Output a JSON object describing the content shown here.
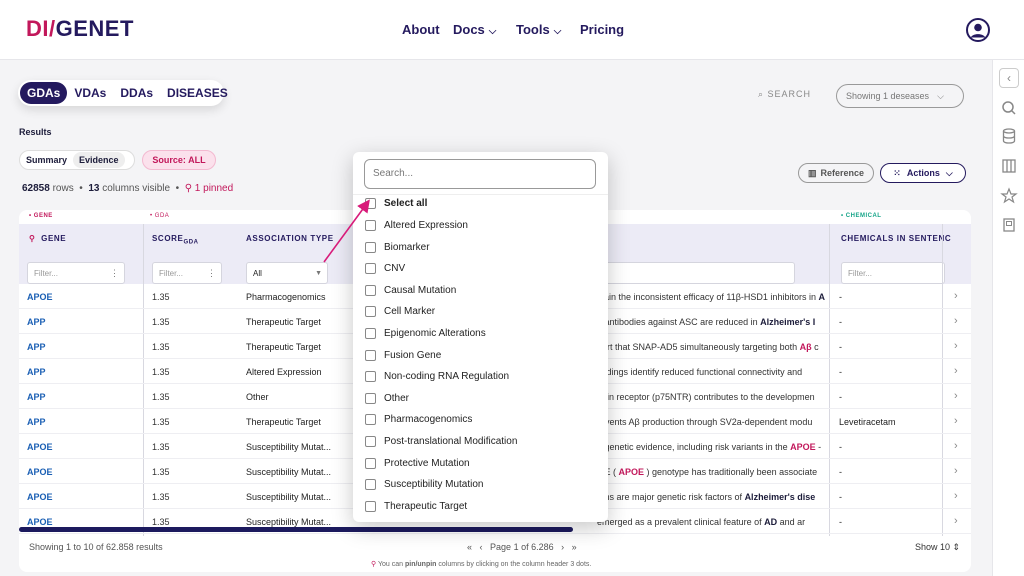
{
  "header": {
    "logo_part1": "DI",
    "logo_part2": "GENET",
    "nav": [
      {
        "label": "About",
        "has_menu": false
      },
      {
        "label": "Docs",
        "has_menu": true
      },
      {
        "label": "Tools",
        "has_menu": true
      },
      {
        "label": "Pricing",
        "has_menu": false
      }
    ]
  },
  "tabs": [
    "GDAs",
    "VDAs",
    "DDAs",
    "DISEASES"
  ],
  "active_tab": "GDAs",
  "search_label": "SEARCH",
  "showing_pill": "Showing 1 deseases",
  "results_title": "Results",
  "view_toggle": {
    "summary": "Summary",
    "evidence": "Evidence"
  },
  "source_pill": "Source: ALL",
  "counts": {
    "rows_value": "62858",
    "rows_label": "rows",
    "cols_value": "13",
    "cols_label": "columns visible",
    "pinned": "1 pinned"
  },
  "buttons": {
    "reference": "Reference",
    "actions": "Actions"
  },
  "table": {
    "groups": {
      "gene": "GENE",
      "gda": "GDA",
      "chemical": "CHEMICAL"
    },
    "headers": {
      "gene": "GENE",
      "score": "SCORE",
      "score_sub": "GDA",
      "assoc": "ASSOCIATION TYPE",
      "chem": "CHEMICALS IN SENTENC"
    },
    "filter_placeholder": "Filter...",
    "assoc_select": "All",
    "rows": [
      {
        "gene": "APOE",
        "score": "1.35",
        "assoc": "Pharmacogenomics",
        "sent": [
          "plain the inconsistent efficacy of 11β-HSD1 inhibitors in ",
          "A"
        ],
        "chem": "-"
      },
      {
        "gene": "APP",
        "score": "1.35",
        "assoc": "Therapeutic Target",
        "sent": [
          "g antibodies against ASC are reduced in ",
          "Alzheimer's I"
        ],
        "chem": "-"
      },
      {
        "gene": "APP",
        "score": "1.35",
        "assoc": "Therapeutic Target",
        "sent": [
          "port that SNAP-AD5 simultaneously targeting both ",
          "Aβ",
          " c"
        ],
        "chem": "-"
      },
      {
        "gene": "APP",
        "score": "1.35",
        "assoc": "Altered Expression",
        "sent": [
          " findings identify reduced functional connectivity and"
        ],
        "chem": "-"
      },
      {
        "gene": "APP",
        "score": "1.35",
        "assoc": "Other",
        "sent": [
          "phin receptor (p75NTR) contributes to the developmen"
        ],
        "chem": "-"
      },
      {
        "gene": "APP",
        "score": "1.35",
        "assoc": "Therapeutic Target",
        "sent": [
          "revents Aβ production through SV2a-dependent modu"
        ],
        "chem": "Levetiracetam"
      },
      {
        "gene": "APOE",
        "score": "1.35",
        "assoc": "Susceptibility Mutat...",
        "sent": [
          "g genetic evidence, including risk variants in the ",
          "APOE",
          " -"
        ],
        "chem": "-"
      },
      {
        "gene": "APOE",
        "score": "1.35",
        "assoc": "Susceptibility Mutat...",
        "sent": [
          "n E ( ",
          "APOE",
          " ) genotype has traditionally been associate"
        ],
        "chem": "-"
      },
      {
        "gene": "APOE",
        "score": "1.35",
        "assoc": "Susceptibility Mutat...",
        "sent": [
          "oms are major genetic risk factors of ",
          "Alzheimer's dise"
        ],
        "chem": "-"
      },
      {
        "gene": "APOE",
        "score": "1.35",
        "assoc": "Susceptibility Mutat...",
        "sent": [
          " emerged as a prevalent clinical feature of ",
          "AD",
          " and ar"
        ],
        "chem": "-"
      }
    ]
  },
  "footer": {
    "showing": "Showing 1 to 10 of 62.858 results",
    "page": "Page 1 of 6.286",
    "show": "Show 10",
    "hint_pre": "You can ",
    "hint_bold": "pin/unpin",
    "hint_post": " columns by clicking on the column header 3 dots."
  },
  "dropdown": {
    "search_placeholder": "Search...",
    "select_all": "Select all",
    "options": [
      "Altered Expression",
      "Biomarker",
      "CNV",
      "Causal Mutation",
      "Cell Marker",
      "Epigenomic Alterations",
      "Fusion Gene",
      "Non-coding RNA Regulation",
      "Other",
      "Pharmacogenomics",
      "Post-translational Modification",
      "Protective Mutation",
      "Susceptibility Mutation",
      "Therapeutic Target"
    ]
  },
  "colors": {
    "brand_pink": "#c2185b",
    "brand_navy": "#241a5e",
    "link_blue": "#1a5fb4",
    "annotation_arrow": "#d81b7a"
  }
}
